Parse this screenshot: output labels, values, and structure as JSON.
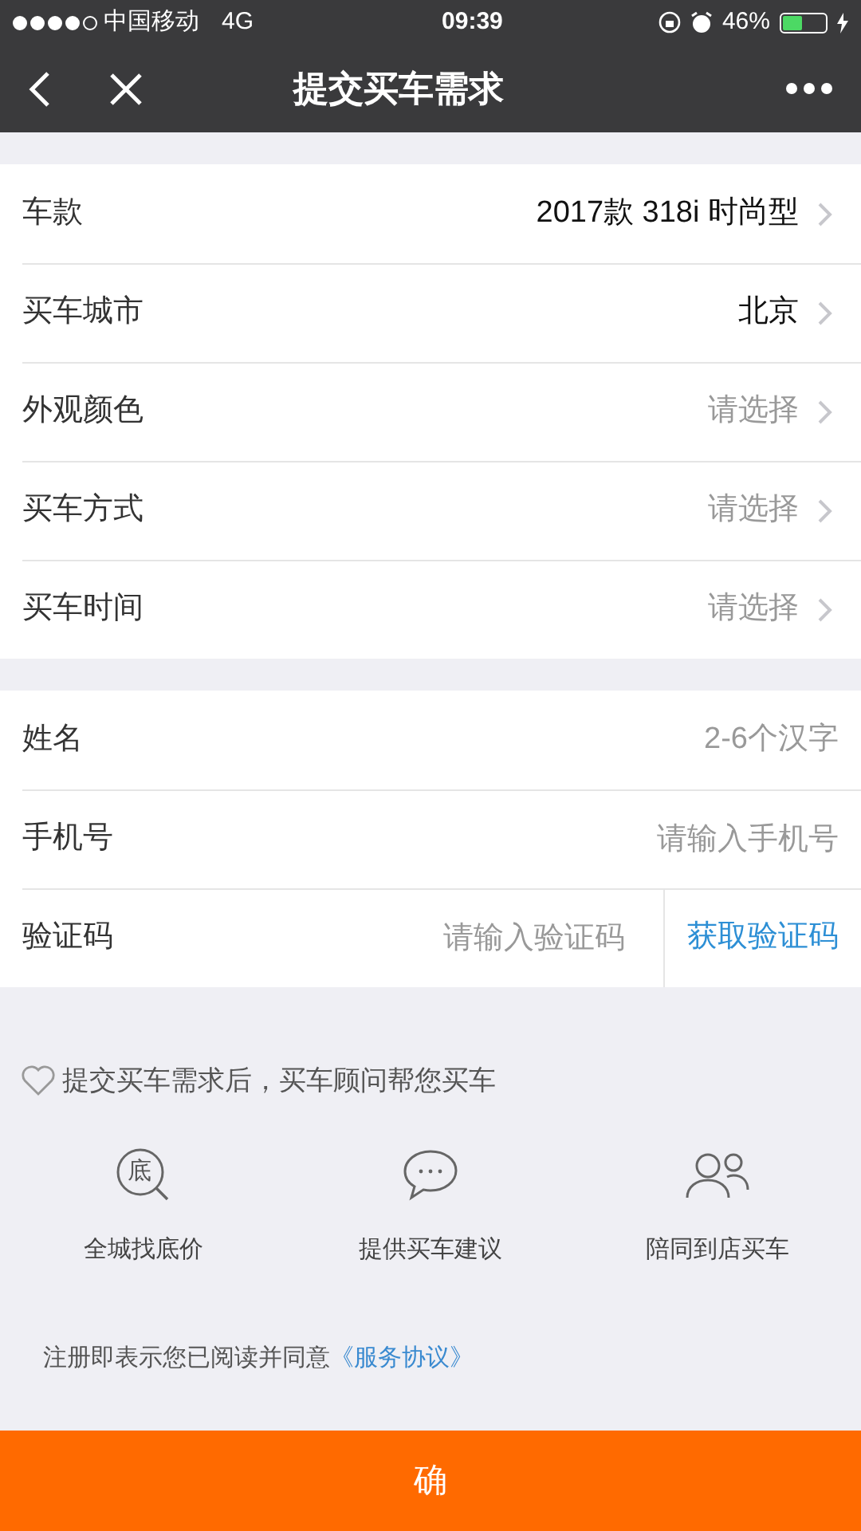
{
  "status_bar": {
    "carrier": "中国移动",
    "network": "4G",
    "time": "09:39",
    "battery": "46%"
  },
  "nav": {
    "title": "提交买车需求"
  },
  "car_section": [
    {
      "label": "车款",
      "value": "2017款 318i 时尚型"
    },
    {
      "label": "买车城市",
      "value": "北京"
    },
    {
      "label": "外观颜色",
      "placeholder": "请选择"
    },
    {
      "label": "买车方式",
      "placeholder": "请选择"
    },
    {
      "label": "买车时间",
      "placeholder": "请选择"
    }
  ],
  "contact_section": [
    {
      "kind": "input",
      "label": "姓名",
      "placeholder": "2-6个汉字"
    },
    {
      "kind": "input",
      "label": "手机号",
      "placeholder": "请输入手机号"
    },
    {
      "kind": "code",
      "label": "验证码",
      "placeholder": "请输入验证码",
      "action": "获取验证码"
    }
  ],
  "promise": "提交买车需求后，买车顾问帮您买车",
  "features": [
    {
      "kind": "price",
      "icon_char": "底",
      "label": "全城找底价"
    },
    {
      "kind": "chat",
      "label": "提供买车建议"
    },
    {
      "kind": "people",
      "label": "陪同到店买车"
    }
  ],
  "agreement": {
    "text": "注册即表示您已阅读并同意",
    "link": "《服务协议》"
  },
  "submit_button": "确"
}
